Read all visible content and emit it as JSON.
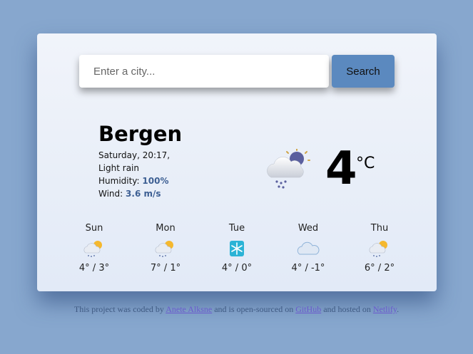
{
  "search": {
    "placeholder": "Enter a city...",
    "button_label": "Search"
  },
  "current": {
    "city": "Bergen",
    "datetime": "Saturday, 20:17,",
    "description": "Light rain",
    "humidity_label": "Humidity:",
    "humidity_value": "100%",
    "wind_label": "Wind:",
    "wind_value": "3.6 m/s",
    "temperature": "4",
    "unit": "°C",
    "icon": "cloud-rain-night-icon"
  },
  "forecast": [
    {
      "day": "Sun",
      "temps": "4° / 3°",
      "icon": "sun-cloud-rain-icon"
    },
    {
      "day": "Mon",
      "temps": "7° / 1°",
      "icon": "sun-cloud-rain-icon"
    },
    {
      "day": "Tue",
      "temps": "4° / 0°",
      "icon": "snowflake-icon"
    },
    {
      "day": "Wed",
      "temps": "4° / -1°",
      "icon": "cloud-icon"
    },
    {
      "day": "Thu",
      "temps": "6° / 2°",
      "icon": "sun-cloud-rain-icon"
    }
  ],
  "footer": {
    "text1": "This project was coded by",
    "author": "Anete Alksne",
    "text2": "and is open-sourced on",
    "github": "GitHub",
    "text3": "and hosted on",
    "netlify": "Netlify",
    "text4": "."
  },
  "colors": {
    "background": "#87a7ce",
    "accent": "#5b89bf",
    "highlight": "#3d5f93"
  }
}
